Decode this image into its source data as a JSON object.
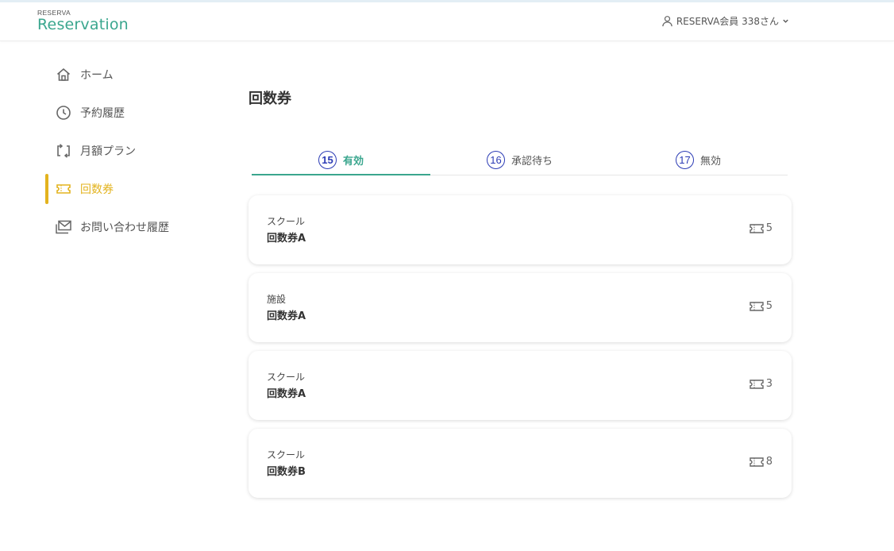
{
  "header": {
    "logo_small": "RESERVA",
    "logo_main": "Reservation",
    "user_label": "RESERVA会員 338さん",
    "user_icon": "user-icon",
    "dropdown_icon": "chevron-down-icon"
  },
  "sidebar": {
    "items": [
      {
        "label": "ホーム",
        "icon": "home-icon"
      },
      {
        "label": "予約履歴",
        "icon": "clock-icon"
      },
      {
        "label": "月額プラン",
        "icon": "repeat-icon"
      },
      {
        "label": "回数券",
        "icon": "ticket-icon",
        "active": true
      },
      {
        "label": "お問い合わせ履歴",
        "icon": "mail-icon"
      }
    ]
  },
  "main": {
    "title": "回数券",
    "tabs": [
      {
        "num": "15",
        "label": "有効",
        "active": true
      },
      {
        "num": "16",
        "label": "承認待ち"
      },
      {
        "num": "17",
        "label": "無効"
      }
    ],
    "cards": [
      {
        "category": "スクール",
        "name": "回数券A",
        "count": "5"
      },
      {
        "category": "施設",
        "name": "回数券A",
        "count": "5"
      },
      {
        "category": "スクール",
        "name": "回数券A",
        "count": "3"
      },
      {
        "category": "スクール",
        "name": "回数券B",
        "count": "8"
      }
    ]
  },
  "colors": {
    "brand": "#3aa68e",
    "active_nav": "#e3b31e",
    "tab_number": "#2b3bb5"
  }
}
